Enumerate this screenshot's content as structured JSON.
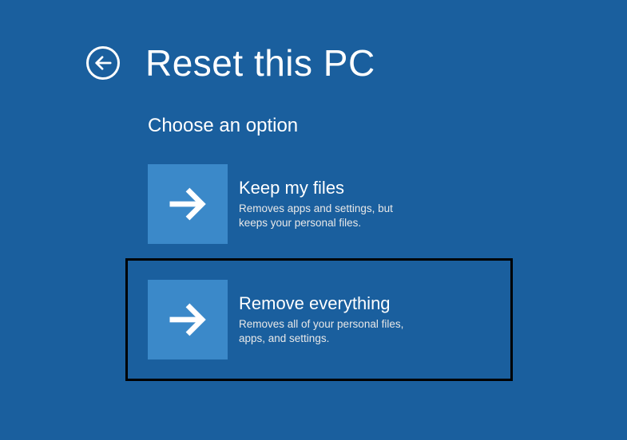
{
  "header": {
    "title": "Reset this PC"
  },
  "subtitle": "Choose an option",
  "options": [
    {
      "title": "Keep my files",
      "description": "Removes apps and settings, but keeps your personal files."
    },
    {
      "title": "Remove everything",
      "description": "Removes all of your personal files, apps, and settings."
    }
  ]
}
